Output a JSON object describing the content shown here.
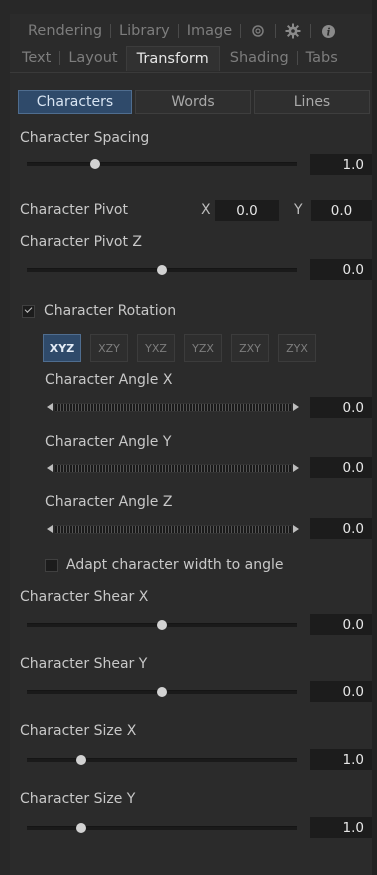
{
  "tabs_row1": [
    "Rendering",
    "Library",
    "Image"
  ],
  "tabs_row2": [
    "Text",
    "Layout",
    "Transform",
    "Shading",
    "Tabs"
  ],
  "active_tab": "Transform",
  "icons": {
    "link": "link-icon",
    "settings": "gear-icon",
    "info": "info-icon"
  },
  "modes": [
    "Characters",
    "Words",
    "Lines"
  ],
  "active_mode": "Characters",
  "character_spacing": {
    "label": "Character Spacing",
    "value": "1.0",
    "slider_fraction": 0.25
  },
  "character_pivot": {
    "label": "Character Pivot",
    "x_label": "X",
    "x_value": "0.0",
    "y_label": "Y",
    "y_value": "0.0"
  },
  "character_pivot_z": {
    "label": "Character Pivot Z",
    "value": "0.0",
    "slider_fraction": 0.5
  },
  "character_rotation": {
    "label": "Character Rotation",
    "checked": true
  },
  "rotation_orders": [
    "XYZ",
    "XZY",
    "YXZ",
    "YZX",
    "ZXY",
    "ZYX"
  ],
  "active_order": "XYZ",
  "angle_x": {
    "label": "Character Angle X",
    "value": "0.0"
  },
  "angle_y": {
    "label": "Character Angle Y",
    "value": "0.0"
  },
  "angle_z": {
    "label": "Character Angle Z",
    "value": "0.0"
  },
  "adapt_width": {
    "label": "Adapt character width to angle",
    "checked": false
  },
  "shear_x": {
    "label": "Character Shear X",
    "value": "0.0",
    "slider_fraction": 0.5
  },
  "shear_y": {
    "label": "Character Shear Y",
    "value": "0.0",
    "slider_fraction": 0.5
  },
  "size_x": {
    "label": "Character Size X",
    "value": "1.0",
    "slider_fraction": 0.2
  },
  "size_y": {
    "label": "Character Size Y",
    "value": "1.0",
    "slider_fraction": 0.2
  },
  "colors": {
    "accent": "#2f4a6a",
    "background": "#282828",
    "field": "#1c1c1c"
  }
}
